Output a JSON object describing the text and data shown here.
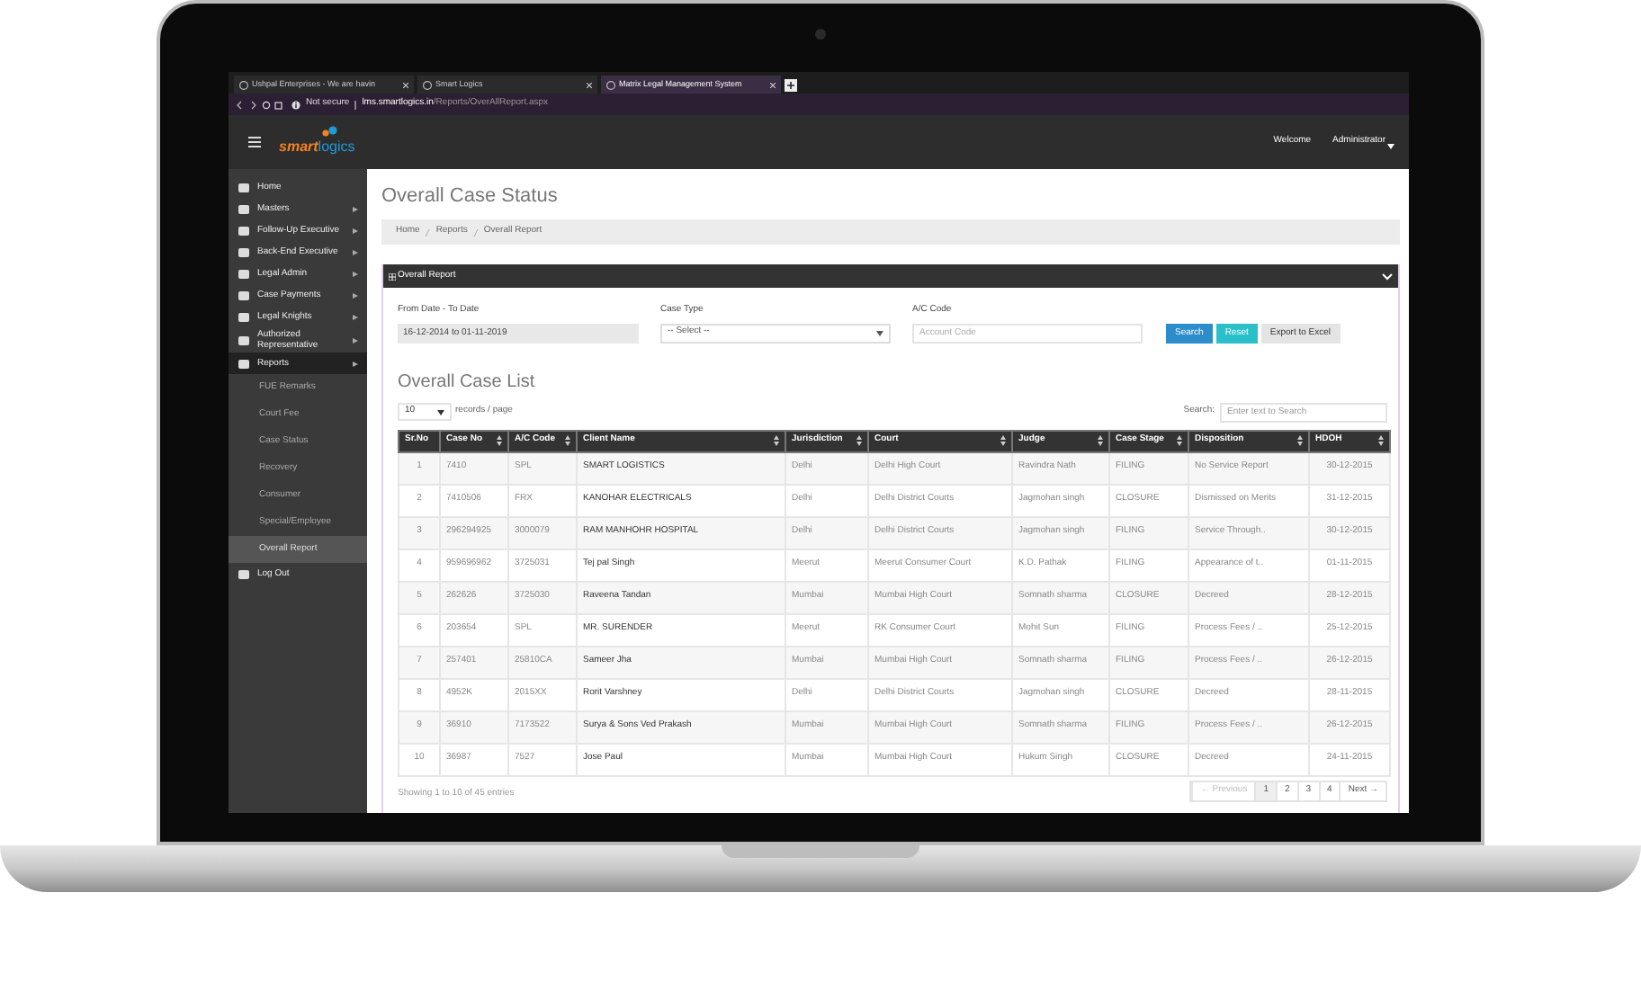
{
  "browser": {
    "tabs": [
      {
        "label": "Ushpal Enterprises - We are havin",
        "selected": false
      },
      {
        "label": "Smart Logics",
        "selected": false
      },
      {
        "label": "Matrix Legal Management System",
        "selected": true
      }
    ],
    "security": "Not secure",
    "url_host": "lms.smartlogics.in",
    "url_path": "/Reports/OverAllReport.aspx"
  },
  "header": {
    "logo": {
      "part_1": "smart",
      "part_2": "logics"
    },
    "welcome": "Welcome",
    "user": "Administrator"
  },
  "sidebar": {
    "items": [
      {
        "label": "Home",
        "expandable": false,
        "expanded": false
      },
      {
        "label": "Masters",
        "expandable": true,
        "expanded": false
      },
      {
        "label": "Follow-Up Executive",
        "expandable": true,
        "expanded": false
      },
      {
        "label": "Back-End Executive",
        "expandable": true,
        "expanded": false
      },
      {
        "label": "Legal Admin",
        "expandable": true,
        "expanded": false
      },
      {
        "label": "Case Payments",
        "expandable": true,
        "expanded": false
      },
      {
        "label": "Legal Knights",
        "expandable": true,
        "expanded": false
      },
      {
        "label": "Authorized Representative",
        "expandable": true,
        "expanded": false
      },
      {
        "label": "Reports",
        "expandable": true,
        "expanded": true,
        "children": [
          {
            "label": "FUE Remarks",
            "selected": false
          },
          {
            "label": "Court Fee",
            "selected": false
          },
          {
            "label": "Case Status",
            "selected": false
          },
          {
            "label": "Recovery",
            "selected": false
          },
          {
            "label": "Consumer",
            "selected": false
          },
          {
            "label": "Special/Employee",
            "selected": false
          },
          {
            "label": "Overall Report",
            "selected": true
          }
        ]
      },
      {
        "label": "Log Out",
        "expandable": false,
        "expanded": false
      }
    ]
  },
  "page_title": "Overall Case Status",
  "breadcrumb": [
    "Home",
    "Reports",
    "Overall Report"
  ],
  "panel": {
    "title": "Overall Report",
    "filters": [
      {
        "kind": "text",
        "label": "From Date - To Date",
        "value": "16-12-2014 to 01-11-2019"
      },
      {
        "kind": "select",
        "label": "Case Type",
        "value": "-- Select --"
      },
      {
        "kind": "input",
        "label": "A/C Code",
        "placeholder": "Account Code"
      }
    ],
    "buttons": [
      {
        "label": "Search",
        "kind": "primary"
      },
      {
        "label": "Reset",
        "kind": "info"
      },
      {
        "label": "Export to Excel",
        "kind": "default"
      }
    ]
  },
  "list_title": "Overall Case List",
  "page_size": {
    "value": "10",
    "label": "records / page"
  },
  "search": {
    "label": "Search:",
    "placeholder": "Enter text to Search"
  },
  "table": {
    "columns": [
      "Sr.No",
      "Case No",
      "A/C Code",
      "Client Name",
      "Jurisdiction",
      "Court",
      "Judge",
      "Case Stage",
      "Disposition",
      "HDOH"
    ],
    "rows": [
      [
        "1",
        "7410",
        "SPL",
        "SMART LOGISTICS",
        "Delhi",
        "Delhi High Court",
        "Ravindra Nath",
        "FILING",
        "No Service Report",
        "30-12-2015"
      ],
      [
        "2",
        "7410506",
        "FRX",
        "KANOHAR ELECTRICALS",
        "Delhi",
        "Delhi District Courts",
        "Jagmohan singh",
        "CLOSURE",
        "Dismissed on Merits",
        "31-12-2015"
      ],
      [
        "3",
        "296294925",
        "3000079",
        "RAM MANHOHR HOSPITAL",
        "Delhi",
        "Delhi District Courts",
        "Jagmohan singh",
        "FILING",
        "Service Through..",
        "30-12-2015"
      ],
      [
        "4",
        "959696962",
        "3725031",
        "Tej pal Singh",
        "Meerut",
        "Meerut Consumer Court",
        "K.D. Pathak",
        "FILING",
        "Appearance of t..",
        "01-11-2015"
      ],
      [
        "5",
        "262626",
        "3725030",
        "Raveena Tandan",
        "Mumbai",
        "Mumbai High Court",
        "Somnath sharma",
        "CLOSURE",
        "Decreed",
        "28-12-2015"
      ],
      [
        "6",
        "203654",
        "SPL",
        "MR. SURENDER",
        "Meerut",
        "RK Consumer Court",
        "Mohit Sun",
        "FILING",
        "Process Fees / ..",
        "25-12-2015"
      ],
      [
        "7",
        "257401",
        "25810CA",
        "Sameer Jha",
        "Mumbai",
        "Mumbai High Court",
        "Somnath sharma",
        "FILING",
        "Process Fees / ..",
        "26-12-2015"
      ],
      [
        "8",
        "4952K",
        "2015XX",
        "Rorit Varshney",
        "Delhi",
        "Delhi District Courts",
        "Jagmohan singh",
        "CLOSURE",
        "Decreed",
        "28-11-2015"
      ],
      [
        "9",
        "36910",
        "7173522",
        "Surya & Sons Ved Prakash",
        "Mumbai",
        "Mumbai High Court",
        "Somnath sharma",
        "FILING",
        "Process Fees / ..",
        "26-12-2015"
      ],
      [
        "10",
        "36987",
        "7527",
        "Jose Paul",
        "Mumbai",
        "Mumbai High Court",
        "Hukum Singh",
        "CLOSURE",
        "Decreed",
        "24-11-2015"
      ]
    ]
  },
  "footer": {
    "info": "Showing 1 to 10 of 45 entries",
    "pages": [
      {
        "label": "← Previous",
        "selected": false,
        "disabled": true
      },
      {
        "label": "1",
        "selected": true,
        "disabled": false
      },
      {
        "label": "2",
        "selected": false,
        "disabled": false
      },
      {
        "label": "3",
        "selected": false,
        "disabled": false
      },
      {
        "label": "4",
        "selected": false,
        "disabled": false
      },
      {
        "label": "Next →",
        "selected": false,
        "disabled": false
      }
    ]
  }
}
